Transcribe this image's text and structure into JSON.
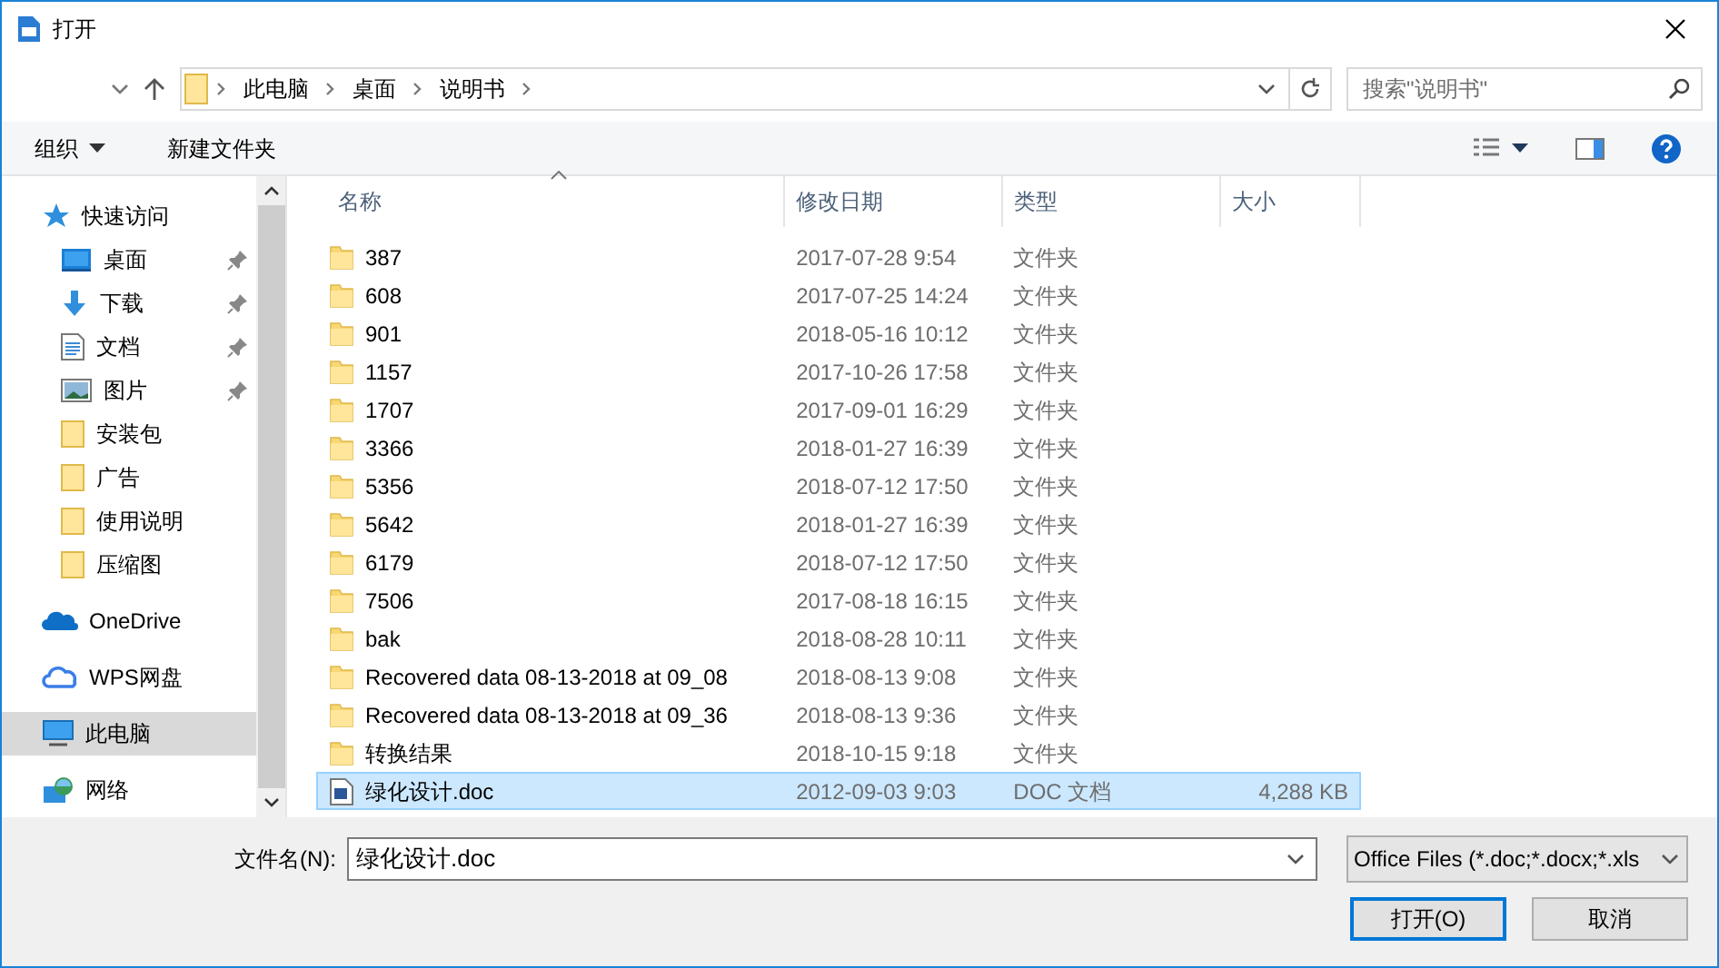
{
  "window": {
    "title": "打开"
  },
  "address": {
    "crumbs": [
      "此电脑",
      "桌面",
      "说明书"
    ]
  },
  "search": {
    "placeholder": "搜索\"说明书\""
  },
  "toolbar": {
    "organize": "组织",
    "new_folder": "新建文件夹"
  },
  "nav": [
    {
      "label": "快速访问",
      "kind": "star",
      "pinned": false,
      "selected": false
    },
    {
      "label": "桌面",
      "kind": "desktop",
      "pinned": true,
      "selected": false
    },
    {
      "label": "下载",
      "kind": "download",
      "pinned": true,
      "selected": false
    },
    {
      "label": "文档",
      "kind": "document",
      "pinned": true,
      "selected": false
    },
    {
      "label": "图片",
      "kind": "pictures",
      "pinned": true,
      "selected": false
    },
    {
      "label": "安装包",
      "kind": "folder",
      "pinned": false,
      "selected": false
    },
    {
      "label": "广告",
      "kind": "folder",
      "pinned": false,
      "selected": false
    },
    {
      "label": "使用说明",
      "kind": "folder",
      "pinned": false,
      "selected": false
    },
    {
      "label": "压缩图",
      "kind": "folder",
      "pinned": false,
      "selected": false
    },
    {
      "label": "OneDrive",
      "kind": "onedrive",
      "pinned": false,
      "selected": false
    },
    {
      "label": "WPS网盘",
      "kind": "cloud",
      "pinned": false,
      "selected": false
    },
    {
      "label": "此电脑",
      "kind": "pc",
      "pinned": false,
      "selected": true
    },
    {
      "label": "网络",
      "kind": "network",
      "pinned": false,
      "selected": false
    }
  ],
  "columns": [
    {
      "label": "名称",
      "sorted": true
    },
    {
      "label": "修改日期",
      "sorted": false
    },
    {
      "label": "类型",
      "sorted": false
    },
    {
      "label": "大小",
      "sorted": false
    }
  ],
  "rows": [
    {
      "name": "387",
      "date": "2017-07-28 9:54",
      "type": "文件夹",
      "kind": "folder",
      "selected": false
    },
    {
      "name": "608",
      "date": "2017-07-25 14:24",
      "type": "文件夹",
      "kind": "folder",
      "selected": false
    },
    {
      "name": "901",
      "date": "2018-05-16 10:12",
      "type": "文件夹",
      "kind": "folder",
      "selected": false
    },
    {
      "name": "1157",
      "date": "2017-10-26 17:58",
      "type": "文件夹",
      "kind": "folder",
      "selected": false
    },
    {
      "name": "1707",
      "date": "2017-09-01 16:29",
      "type": "文件夹",
      "kind": "folder",
      "selected": false
    },
    {
      "name": "3366",
      "date": "2018-01-27 16:39",
      "type": "文件夹",
      "kind": "folder",
      "selected": false
    },
    {
      "name": "5356",
      "date": "2018-07-12 17:50",
      "type": "文件夹",
      "kind": "folder",
      "selected": false
    },
    {
      "name": "5642",
      "date": "2018-01-27 16:39",
      "type": "文件夹",
      "kind": "folder",
      "selected": false
    },
    {
      "name": "6179",
      "date": "2018-07-12 17:50",
      "type": "文件夹",
      "kind": "folder",
      "selected": false
    },
    {
      "name": "7506",
      "date": "2017-08-18 16:15",
      "type": "文件夹",
      "kind": "folder",
      "selected": false
    },
    {
      "name": "bak",
      "date": "2018-08-28 10:11",
      "type": "文件夹",
      "kind": "folder",
      "selected": false
    },
    {
      "name": "Recovered data 08-13-2018 at 09_08",
      "date": "2018-08-13 9:08",
      "type": "文件夹",
      "kind": "folder",
      "selected": false
    },
    {
      "name": "Recovered data 08-13-2018 at 09_36",
      "date": "2018-08-13 9:36",
      "type": "文件夹",
      "kind": "folder",
      "selected": false
    },
    {
      "name": "转换结果",
      "date": "2018-10-15 9:18",
      "type": "文件夹",
      "kind": "folder",
      "selected": false
    },
    {
      "name": "绿化设计.doc",
      "date": "2012-09-03 9:03",
      "type": "DOC 文档",
      "size": "4,288 KB",
      "kind": "doc",
      "selected": true
    }
  ],
  "filename": {
    "label": "文件名(N):",
    "value": "绿化设计.doc"
  },
  "filetype": {
    "value": "Office Files (*.doc;*.docx;*.xls"
  },
  "buttons": [
    {
      "label": "打开(O)",
      "default": true
    },
    {
      "label": "取消",
      "default": false
    }
  ]
}
